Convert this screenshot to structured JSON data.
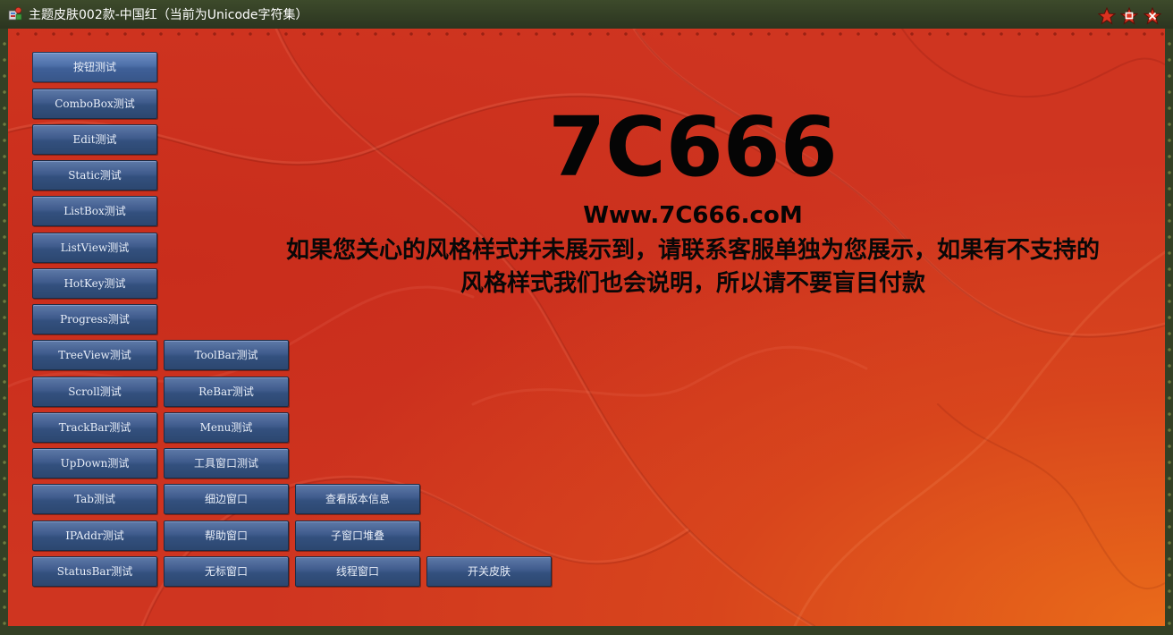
{
  "window": {
    "title": "主题皮肤002款-中国红（当前为Unicode字符集）",
    "icon": "app-icon",
    "controls": [
      "skin-star-icon",
      "maximize-icon",
      "close-icon"
    ]
  },
  "colors": {
    "background": "#cf3520",
    "background_corner": "#e86e1c",
    "button": "#3f5b8c",
    "button_text": "#e8eef8",
    "heading_text": "#050505",
    "frame": "#344025"
  },
  "buttons": {
    "button_test": "按钮测试",
    "combobox_test": "ComboBox测试",
    "edit_test": "Edit测试",
    "static_test": "Static测试",
    "listbox_test": "ListBox测试",
    "listview_test": "ListView测试",
    "hotkey_test": "HotKey测试",
    "progress_test": "Progress测试",
    "treeview_test": "TreeView测试",
    "toolbar_test": "ToolBar测试",
    "scroll_test": "Scroll测试",
    "rebar_test": "ReBar测试",
    "trackbar_test": "TrackBar测试",
    "menu_test": "Menu测试",
    "updown_test": "UpDown测试",
    "tool_window_test": "工具窗口测试",
    "tab_test": "Tab测试",
    "thin_border_window": "细边窗口",
    "view_version": "查看版本信息",
    "ipaddr_test": "IPAddr测试",
    "help_window": "帮助窗口",
    "child_window_stack": "子窗口堆叠",
    "statusbar_test": "StatusBar测试",
    "untitled_window": "无标窗口",
    "thread_window": "线程窗口",
    "toggle_skin": "开关皮肤"
  },
  "content": {
    "brand": "7C666",
    "website": "Www.7C666.coM",
    "notice": "如果您关心的风格样式并未展示到，请联系客服单独为您展示，如果有不支持的风格样式我们也会说明，所以请不要盲目付款"
  }
}
